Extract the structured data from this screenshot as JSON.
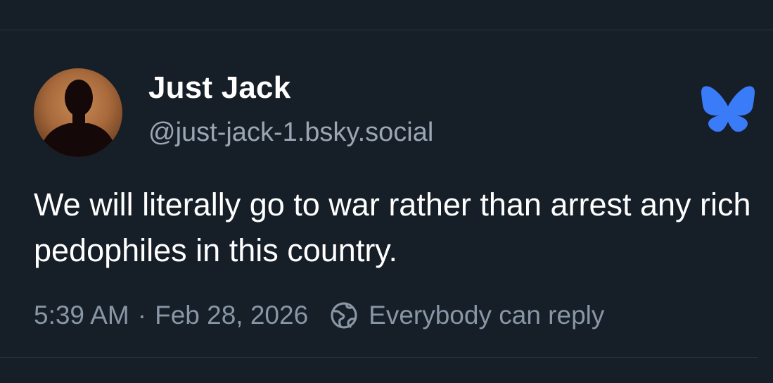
{
  "post": {
    "author": {
      "display_name": "Just Jack",
      "handle": "@just-jack-1.bsky.social",
      "avatar_icon": "silhouette-avatar"
    },
    "text": "We will literally go to war rather than arrest any rich pedophiles in this country.",
    "time": "5:39 AM",
    "separator": "·",
    "date": "Feb 28, 2026",
    "reply_setting": "Everybody can reply",
    "reply_icon": "globe-icon"
  },
  "brand": {
    "logo": "bluesky-butterfly-icon",
    "accent": "#3a7bf7"
  },
  "colors": {
    "background": "#161e27",
    "text_primary": "#ffffff",
    "text_secondary": "#9aa6b4",
    "divider": "#2b3440"
  }
}
